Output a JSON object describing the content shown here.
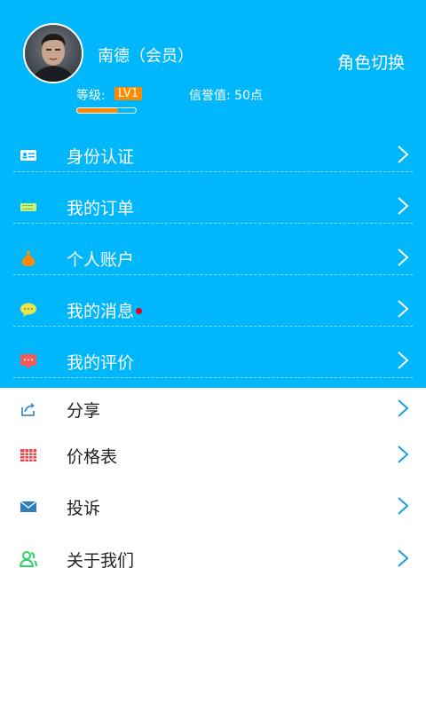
{
  "profile": {
    "name": "南德（会员）",
    "role_switch": "角色切换",
    "level_label": "等级:",
    "level_value": "LV1",
    "credit_text": "信誉值: 50点",
    "level_progress": 0.7
  },
  "menu_blue": [
    {
      "label": "身份认证",
      "icon": "id-card-icon",
      "has_badge": false
    },
    {
      "label": "我的订单",
      "icon": "ticket-icon",
      "has_badge": false
    },
    {
      "label": "个人账户",
      "icon": "money-bag-icon",
      "has_badge": false
    },
    {
      "label": "我的消息",
      "icon": "chat-bubble-icon",
      "has_badge": true
    },
    {
      "label": "我的评价",
      "icon": "comment-icon",
      "has_badge": false
    }
  ],
  "menu_white": [
    {
      "label": "分享",
      "icon": "share-icon"
    },
    {
      "label": "价格表",
      "icon": "table-icon"
    },
    {
      "label": "投诉",
      "icon": "envelope-icon"
    },
    {
      "label": "关于我们",
      "icon": "contacts-icon"
    }
  ],
  "colors": {
    "header_bg": "#00b7fb",
    "level_badge": "#ff8a00",
    "message_dot": "#e60012",
    "chevron_white": "#ffffff",
    "chevron_blue": "#1a9fe0"
  }
}
